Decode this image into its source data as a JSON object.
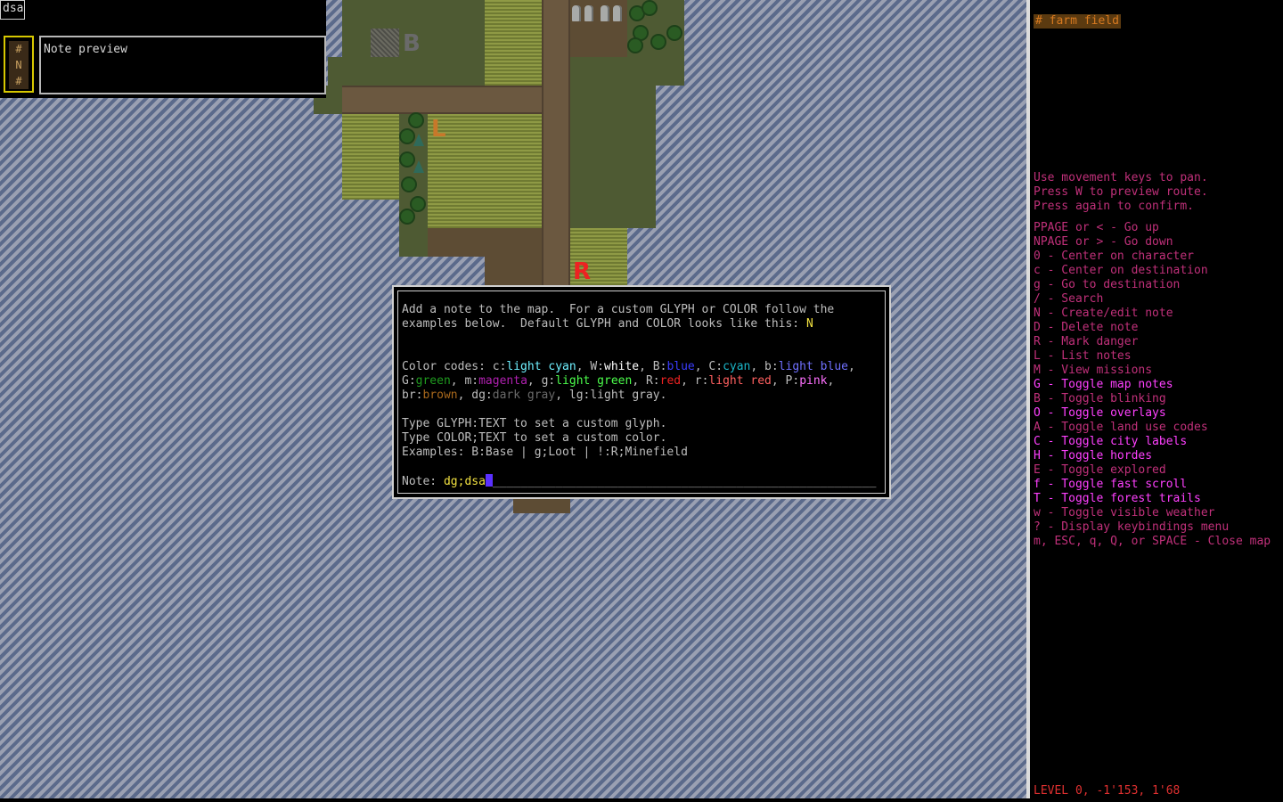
{
  "search": {
    "value": "dsa"
  },
  "note_icon": {
    "glyphs": [
      "#",
      "N",
      "#"
    ]
  },
  "note_preview": {
    "text": "Note preview"
  },
  "map": {
    "labels": [
      {
        "name": "map-note-base",
        "glyph": "B",
        "color": "#6a6a6a"
      },
      {
        "name": "map-note-loot",
        "glyph": "L",
        "color": "#c8782a"
      },
      {
        "name": "map-note-danger",
        "glyph": "R",
        "color": "#ee2222"
      }
    ]
  },
  "dialog": {
    "intro_1": "Add a note to the map.  For a custom GLYPH or COLOR follow the",
    "intro_2_prefix": "examples below.  Default GLYPH and COLOR looks like this: ",
    "default_glyph": "N",
    "codes_prefix": "Color codes: ",
    "color_codes_line1": [
      {
        "code": "c:",
        "name": "light cyan",
        "color": "#6ff0ff",
        "sep": ", "
      },
      {
        "code": "W:",
        "name": "white",
        "color": "#ffffff",
        "sep": ", "
      },
      {
        "code": "B:",
        "name": "blue",
        "color": "#3a3cff",
        "sep": ", "
      },
      {
        "code": "C:",
        "name": "cyan",
        "color": "#1bb6c8",
        "sep": ", "
      },
      {
        "code": "b:",
        "name": "light blue",
        "color": "#7070ff",
        "sep": ","
      }
    ],
    "color_codes_line2": [
      {
        "code": "G:",
        "name": "green",
        "color": "#1f9b1f",
        "sep": ", "
      },
      {
        "code": "m:",
        "name": "magenta",
        "color": "#b020b0",
        "sep": ", "
      },
      {
        "code": "g:",
        "name": "light green",
        "color": "#4cff4c",
        "sep": ", "
      },
      {
        "code": "R:",
        "name": "red",
        "color": "#ee2222",
        "sep": ", "
      },
      {
        "code": "r:",
        "name": "light red",
        "color": "#ff6060",
        "sep": ", "
      },
      {
        "code": "P:",
        "name": "pink",
        "color": "#ff70ff",
        "sep": ","
      }
    ],
    "color_codes_line3": [
      {
        "code": "br:",
        "name": "brown",
        "color": "#a8681c",
        "sep": ", "
      },
      {
        "code": "dg:",
        "name": "dark gray",
        "color": "#6a6a6a",
        "sep": ", "
      },
      {
        "code": "lg:",
        "name": "light gray",
        "color": "#bdbdbd",
        "sep": "."
      }
    ],
    "glyph_help": "Type GLYPH:TEXT to set a custom glyph.",
    "color_help": "Type COLOR;TEXT to set a custom color.",
    "examples": "Examples: B:Base | g;Loot | !:R;Minefield",
    "note_label": "Note: ",
    "note_value": "dg;dsa",
    "underline": "_______________________________________________________"
  },
  "sidebar": {
    "terrain": "# farm field",
    "pan_hints": [
      "Use movement keys to pan.",
      "Press W to preview route.",
      "Press again to confirm."
    ],
    "keybindings": [
      {
        "text": "PPAGE or < - Go up",
        "active": false
      },
      {
        "text": "NPAGE or > - Go down",
        "active": false
      },
      {
        "text": "0 - Center on character",
        "active": false
      },
      {
        "text": "c - Center on destination",
        "active": false
      },
      {
        "text": "g - Go to destination",
        "active": false
      },
      {
        "text": "/ - Search",
        "active": false
      },
      {
        "text": "N - Create/edit note",
        "active": false
      },
      {
        "text": "D - Delete note",
        "active": false
      },
      {
        "text": "R - Mark danger",
        "active": false
      },
      {
        "text": "L - List notes",
        "active": false
      },
      {
        "text": "M - View missions",
        "active": false
      },
      {
        "text": "G - Toggle map notes",
        "active": true
      },
      {
        "text": "B - Toggle blinking",
        "active": false
      },
      {
        "text": "O - Toggle overlays",
        "active": true
      },
      {
        "text": "A - Toggle land use codes",
        "active": false
      },
      {
        "text": "C - Toggle city labels",
        "active": true
      },
      {
        "text": "H - Toggle hordes",
        "active": true
      },
      {
        "text": "E - Toggle explored",
        "active": false
      },
      {
        "text": "f - Toggle fast scroll",
        "active": true
      },
      {
        "text": "T - Toggle forest trails",
        "active": true
      },
      {
        "text": "w - Toggle visible weather",
        "active": false
      },
      {
        "text": "? - Display keybindings menu",
        "active": false
      },
      {
        "text": "m, ESC, q, Q, or SPACE - Close map",
        "active": false
      }
    ],
    "level": "LEVEL 0, -1'153, 1'68"
  }
}
